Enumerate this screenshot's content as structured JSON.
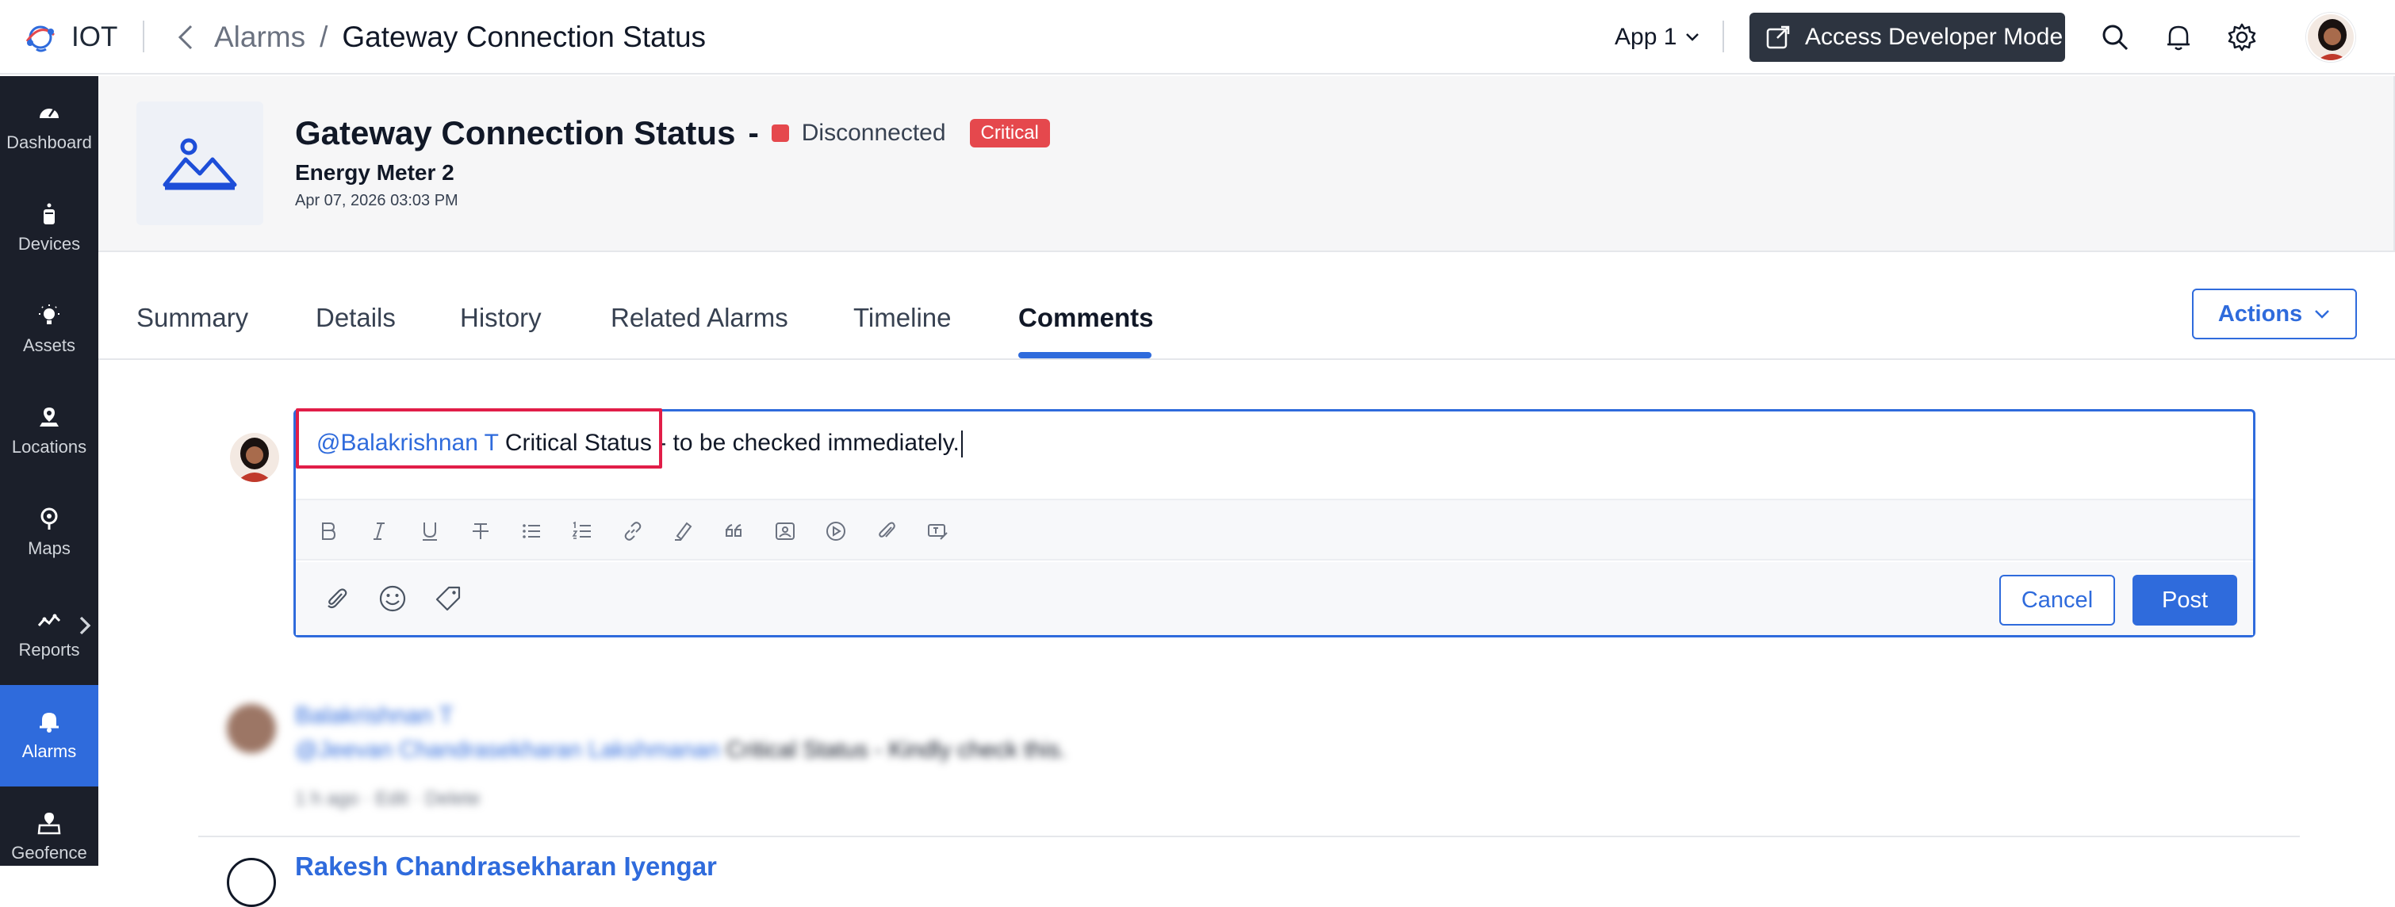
{
  "topbar": {
    "brand": "IOT",
    "breadcrumb_parent": "Alarms",
    "breadcrumb_separator": "/",
    "breadcrumb_current": "Gateway Connection Status",
    "app_selector": "App 1",
    "developer_button": "Access Developer Mode",
    "icons": [
      "search-icon",
      "bell-icon",
      "gear-icon"
    ]
  },
  "sidebar": {
    "items": [
      {
        "label": "Dashboard",
        "icon": "dashboard-icon"
      },
      {
        "label": "Devices",
        "icon": "device-icon"
      },
      {
        "label": "Assets",
        "icon": "asset-icon"
      },
      {
        "label": "Locations",
        "icon": "location-icon"
      },
      {
        "label": "Maps",
        "icon": "map-pin-icon"
      },
      {
        "label": "Reports",
        "icon": "reports-icon"
      },
      {
        "label": "Alarms",
        "icon": "bell-icon",
        "active": true
      },
      {
        "label": "Geofence",
        "icon": "geofence-icon"
      }
    ]
  },
  "alarm": {
    "title": "Gateway Connection Status",
    "title_separator": "-",
    "status": "Disconnected",
    "severity": "Critical",
    "asset": "Energy Meter 2",
    "timestamp": "Apr 07, 2026 03:03 PM"
  },
  "tabs": {
    "items": [
      "Summary",
      "Details",
      "History",
      "Related Alarms",
      "Timeline",
      "Comments"
    ],
    "active": "Comments",
    "actions_label": "Actions"
  },
  "editor": {
    "mention": "@Balakrishnan T",
    "text_highlighted": "Critical Status",
    "text_rest": " - to be checked immediately.",
    "toolbar_icons": [
      "bold-icon",
      "italic-icon",
      "underline-icon",
      "strikethrough-icon",
      "bullet-list-icon",
      "numbered-list-icon",
      "link-icon",
      "highlighter-icon",
      "quote-icon",
      "image-icon",
      "video-icon",
      "attachment-link-icon",
      "clear-format-icon"
    ],
    "cancel_label": "Cancel",
    "post_label": "Post"
  },
  "comments": [
    {
      "author": "Balakrishnan T",
      "mention": "@Jeevan Chandrasekharan Lakshmanan",
      "text": "Critical Status - Kindly check this.",
      "meta": "1 h ago · Edit · Delete"
    },
    {
      "author": "Rakesh Chandrasekharan Iyengar"
    }
  ],
  "colors": {
    "accent": "#2f6bdc",
    "sidebar_bg": "#1b1f2a",
    "critical": "#e5484d",
    "highlight_box": "#e11d48"
  }
}
